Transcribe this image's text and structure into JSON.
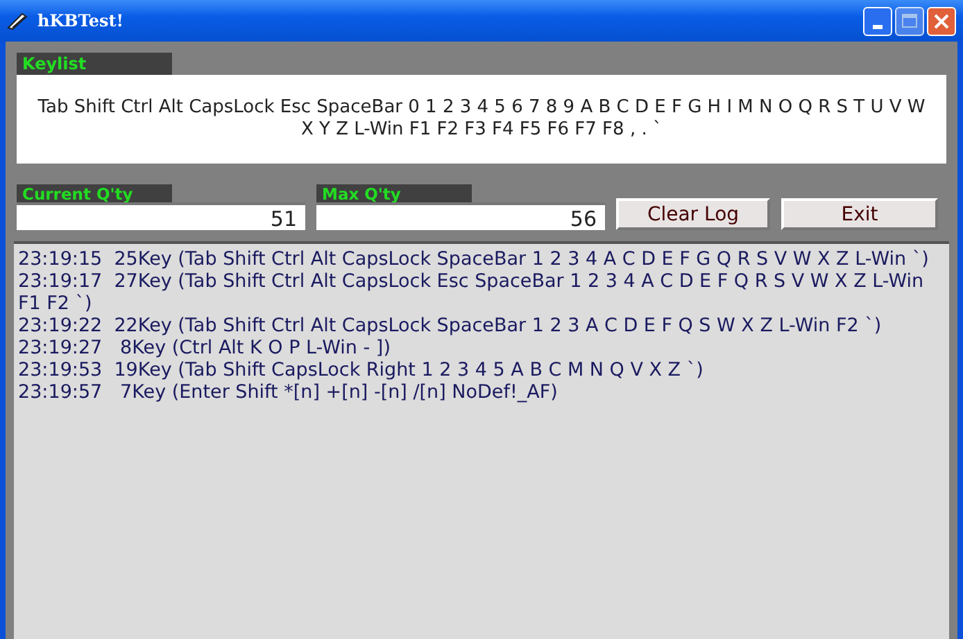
{
  "window": {
    "title": "hKBTest!"
  },
  "keylist": {
    "label": "Keylist",
    "text": "Tab Shift Ctrl Alt CapsLock Esc SpaceBar 0 1 2 3 4 5 6 7 8 9 A B C D E F G H I M N O Q R S T U V W X Y Z L-Win F1 F2 F3 F4 F5 F6 F7 F8 , . `"
  },
  "current_qty": {
    "label": "Current Q'ty",
    "value": "51"
  },
  "max_qty": {
    "label": "Max Q'ty",
    "value": "56"
  },
  "buttons": [
    "Clear Log",
    "Exit"
  ],
  "log": [
    "23:19:15  25Key (Tab Shift Ctrl Alt CapsLock SpaceBar 1 2 3 4 A C D E F G Q R S V W X Z L-Win `)",
    "23:19:17  27Key (Tab Shift Ctrl Alt CapsLock Esc SpaceBar 1 2 3 4 A C D E F Q R S V W X Z L-Win F1 F2 `)",
    "23:19:22  22Key (Tab Shift Ctrl Alt CapsLock SpaceBar 1 2 3 A C D E F Q S W X Z L-Win F2 `)",
    "23:19:27   8Key (Ctrl Alt K O P L-Win - ])",
    "23:19:53  19Key (Tab Shift CapsLock Right 1 2 3 4 5 A B C M N Q V X Z `)",
    "23:19:57   7Key (Enter Shift *[n] +[n] -[n] /[n] NoDef!_AF)"
  ]
}
